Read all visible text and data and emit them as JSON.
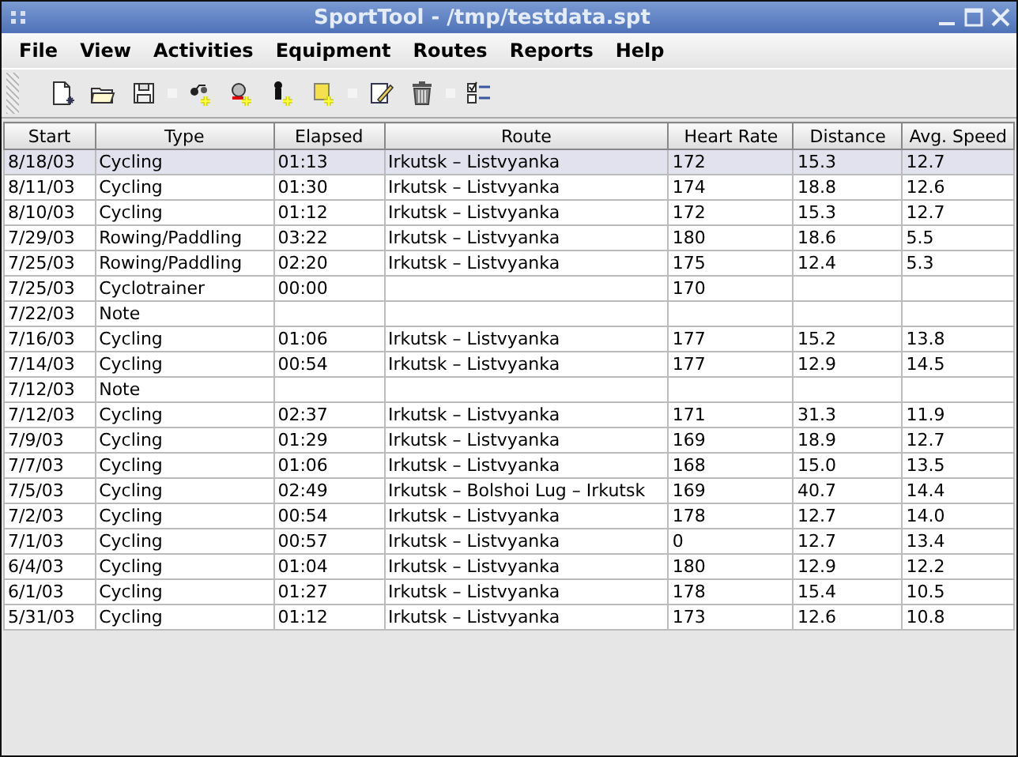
{
  "window": {
    "title": "SportTool - /tmp/testdata.spt"
  },
  "menu": [
    "File",
    "View",
    "Activities",
    "Equipment",
    "Routes",
    "Reports",
    "Help"
  ],
  "toolbar": [
    {
      "kind": "new"
    },
    {
      "kind": "open"
    },
    {
      "kind": "save"
    },
    {
      "kind": "separator"
    },
    {
      "kind": "add-bike"
    },
    {
      "kind": "add-shoe"
    },
    {
      "kind": "add-person"
    },
    {
      "kind": "add-note"
    },
    {
      "kind": "separator"
    },
    {
      "kind": "edit"
    },
    {
      "kind": "delete"
    },
    {
      "kind": "separator"
    },
    {
      "kind": "checklist"
    }
  ],
  "table": {
    "columns": [
      "Start",
      "Type",
      "Elapsed",
      "Route",
      "Heart Rate",
      "Distance",
      "Avg. Speed"
    ],
    "rows": [
      {
        "selected": true,
        "cells": [
          "8/18/03",
          "Cycling",
          "01:13",
          "Irkutsk – Listvyanka",
          "172",
          "15.3",
          "12.7"
        ]
      },
      {
        "selected": false,
        "cells": [
          "8/11/03",
          "Cycling",
          "01:30",
          "Irkutsk – Listvyanka",
          "174",
          "18.8",
          "12.6"
        ]
      },
      {
        "selected": false,
        "cells": [
          "8/10/03",
          "Cycling",
          "01:12",
          "Irkutsk – Listvyanka",
          "172",
          "15.3",
          "12.7"
        ]
      },
      {
        "selected": false,
        "cells": [
          "7/29/03",
          "Rowing/Paddling",
          "03:22",
          "Irkutsk – Listvyanka",
          "180",
          "18.6",
          "5.5"
        ]
      },
      {
        "selected": false,
        "cells": [
          "7/25/03",
          "Rowing/Paddling",
          "02:20",
          "Irkutsk – Listvyanka",
          "175",
          "12.4",
          "5.3"
        ]
      },
      {
        "selected": false,
        "cells": [
          "7/25/03",
          "Cyclotrainer",
          "00:00",
          null,
          "170",
          null,
          null
        ]
      },
      {
        "selected": false,
        "cells": [
          "7/22/03",
          "Note",
          null,
          null,
          null,
          null,
          null
        ]
      },
      {
        "selected": false,
        "cells": [
          "7/16/03",
          "Cycling",
          "01:06",
          "Irkutsk – Listvyanka",
          "177",
          "15.2",
          "13.8"
        ]
      },
      {
        "selected": false,
        "cells": [
          "7/14/03",
          "Cycling",
          "00:54",
          "Irkutsk – Listvyanka",
          "177",
          "12.9",
          "14.5"
        ]
      },
      {
        "selected": false,
        "cells": [
          "7/12/03",
          "Note",
          null,
          null,
          null,
          null,
          null
        ]
      },
      {
        "selected": false,
        "cells": [
          "7/12/03",
          "Cycling",
          "02:37",
          "Irkutsk – Listvyanka",
          "171",
          "31.3",
          "11.9"
        ]
      },
      {
        "selected": false,
        "cells": [
          "7/9/03",
          "Cycling",
          "01:29",
          "Irkutsk – Listvyanka",
          "169",
          "18.9",
          "12.7"
        ]
      },
      {
        "selected": false,
        "cells": [
          "7/7/03",
          "Cycling",
          "01:06",
          "Irkutsk – Listvyanka",
          "168",
          "15.0",
          "13.5"
        ]
      },
      {
        "selected": false,
        "cells": [
          "7/5/03",
          "Cycling",
          "02:49",
          "Irkutsk – Bolshoi Lug – Irkutsk",
          "169",
          "40.7",
          "14.4"
        ]
      },
      {
        "selected": false,
        "cells": [
          "7/2/03",
          "Cycling",
          "00:54",
          "Irkutsk – Listvyanka",
          "178",
          "12.7",
          "14.0"
        ]
      },
      {
        "selected": false,
        "cells": [
          "7/1/03",
          "Cycling",
          "00:57",
          "Irkutsk – Listvyanka",
          "0",
          "12.7",
          "13.4"
        ]
      },
      {
        "selected": false,
        "cells": [
          "6/4/03",
          "Cycling",
          "01:04",
          "Irkutsk – Listvyanka",
          "180",
          "12.9",
          "12.2"
        ]
      },
      {
        "selected": false,
        "cells": [
          "6/1/03",
          "Cycling",
          "01:27",
          "Irkutsk – Listvyanka",
          "178",
          "15.4",
          "10.5"
        ]
      },
      {
        "selected": false,
        "cells": [
          "5/31/03",
          "Cycling",
          "01:12",
          "Irkutsk – Listvyanka",
          "173",
          "12.6",
          "10.8"
        ]
      }
    ]
  }
}
